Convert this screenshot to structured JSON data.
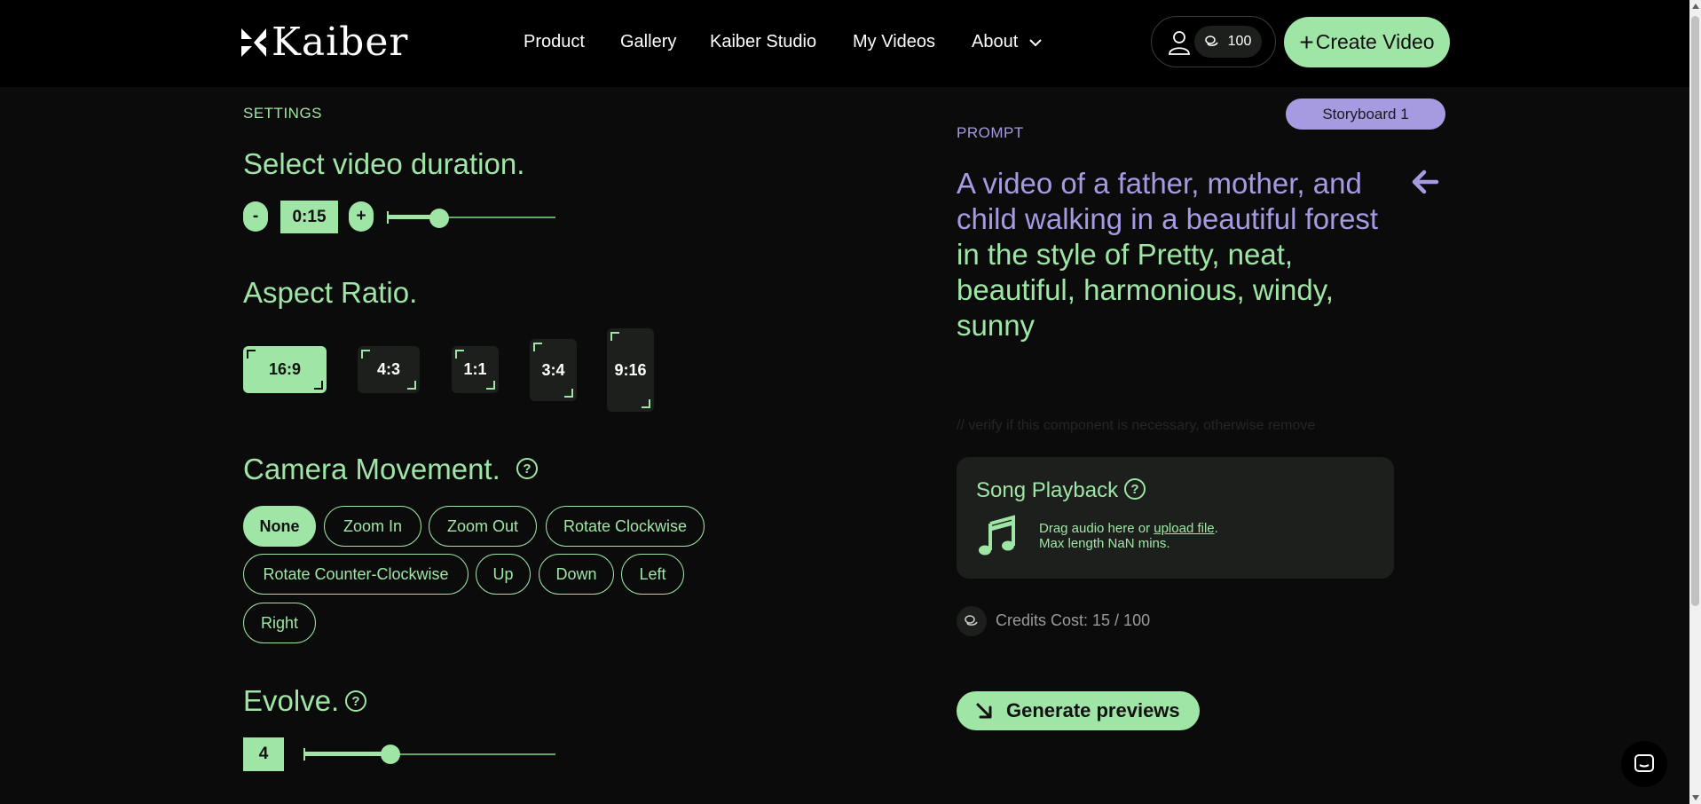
{
  "header": {
    "brand": "Kaiber",
    "nav": [
      "Product",
      "Gallery",
      "Kaiber Studio",
      "My Videos",
      "About"
    ],
    "credits": "100",
    "create_button": "Create Video",
    "create_plus": "+"
  },
  "settings": {
    "label": "SETTINGS",
    "duration": {
      "title": "Select video duration.",
      "minus": "-",
      "value": "0:15",
      "plus": "+",
      "slider_fraction": 0.32
    },
    "aspect_ratio": {
      "title": "Aspect Ratio.",
      "options": [
        "16:9",
        "4:3",
        "1:1",
        "3:4",
        "9:16"
      ],
      "selected": "16:9"
    },
    "camera": {
      "title": "Camera Movement.",
      "help": "?",
      "options": [
        "None",
        "Zoom In",
        "Zoom Out",
        "Rotate Clockwise",
        "Rotate Counter-Clockwise",
        "Up",
        "Down",
        "Left",
        "Right"
      ],
      "selected": "None"
    },
    "evolve": {
      "title": "Evolve.",
      "help": "?",
      "value": "4",
      "slider_fraction": 0.34
    }
  },
  "prompt": {
    "storyboard": "Storyboard 1",
    "label": "PROMPT",
    "subject": "A video of a father, mother, and child walking in a beautiful forest",
    "style": "in the style of Pretty, neat, beautiful, harmonious, windy, sunny",
    "dev_comment": "// verify if this component is necessary, otherwise remove"
  },
  "song": {
    "title": "Song Playback",
    "help": "?",
    "drag_text": "Drag audio here or ",
    "upload_link": "upload file",
    "drag_suffix": ".",
    "max_length": "Max length NaN mins."
  },
  "cost": {
    "text": "Credits Cost: 15 / 100"
  },
  "generate_button": "Generate previews",
  "colors": {
    "accent_green": "#9fe5a5",
    "accent_purple": "#a69ae0",
    "background": "#0b0b0b",
    "card": "#1d1f1d"
  }
}
